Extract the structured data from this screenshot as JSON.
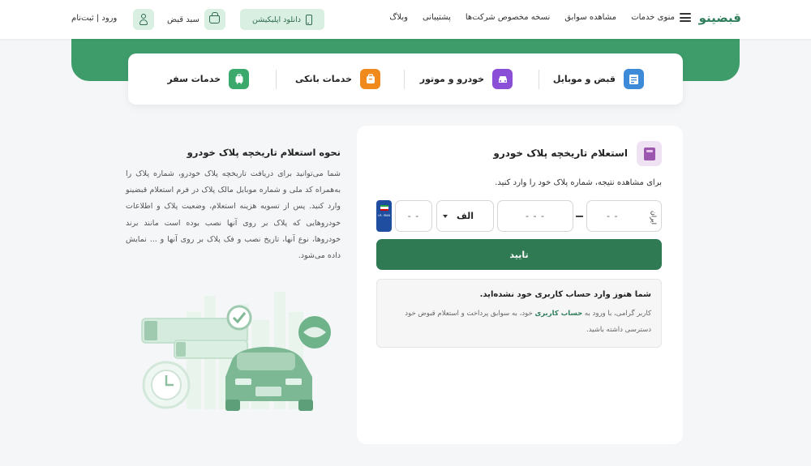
{
  "header": {
    "logo": "قبضینو",
    "menu_label": "منوی خدمات",
    "nav": [
      "مشاهده سوابق",
      "نسخه مخصوص شرکت‌ها",
      "پشتیبانی",
      "وبلاگ"
    ],
    "app_button": "دانلود اپلیکیشن",
    "basket_label": "سبد قبض",
    "login_label": "ورود | ثبت‌نام"
  },
  "services": [
    {
      "label": "قبض و موبایل",
      "color": "#3d8bd8"
    },
    {
      "label": "خودرو و موتور",
      "color": "#8a4fd6"
    },
    {
      "label": "خدمات بانکی",
      "color": "#f08a1c"
    },
    {
      "label": "خدمات سفر",
      "color": "#3aa96b"
    }
  ],
  "form": {
    "title": "استعلام تاریخچه پلاک خودرو",
    "subtitle": "برای مشاهده نتیجه، شماره پلاک خود را وارد کنید.",
    "iran_label": "ایران",
    "plate_part_region": "- -",
    "plate_part_three": "- - -",
    "plate_letter": "الف",
    "plate_part_two": "- -",
    "flag_text": "I.R. IRAN",
    "confirm_button": "تایید"
  },
  "notice": {
    "title": "شما هنوز وارد حساب کاربری خود نشده‌اید.",
    "body_before": "کاربر گرامی، با ورود به ",
    "body_link": "حساب کاربری",
    "body_after": " خود، به سوابق پرداخت و استعلام قبوض خود دسترسی داشته باشید."
  },
  "info": {
    "title": "نحوه استعلام تاریخچه پلاک خودرو",
    "body": "شما می‌توانید برای دریافت تاریخچه پلاک خودرو، شماره پلاک را به‌همراه کد ملی و شماره موبایل مالک پلاک در فرم استعلام قبضینو وارد کنید. پس از تسویه هزینه استعلام، وضعیت پلاک و اطلاعات خودروهایی که پلاک بر روی آنها نصب بوده است مانند برند خودروها، نوع آنها، تاریخ نصب و فک پلاک بر روی آنها و ... نمایش داده می‌شود."
  },
  "colors": {
    "brand_green": "#3e9c6b",
    "button_green": "#2f7a52"
  }
}
